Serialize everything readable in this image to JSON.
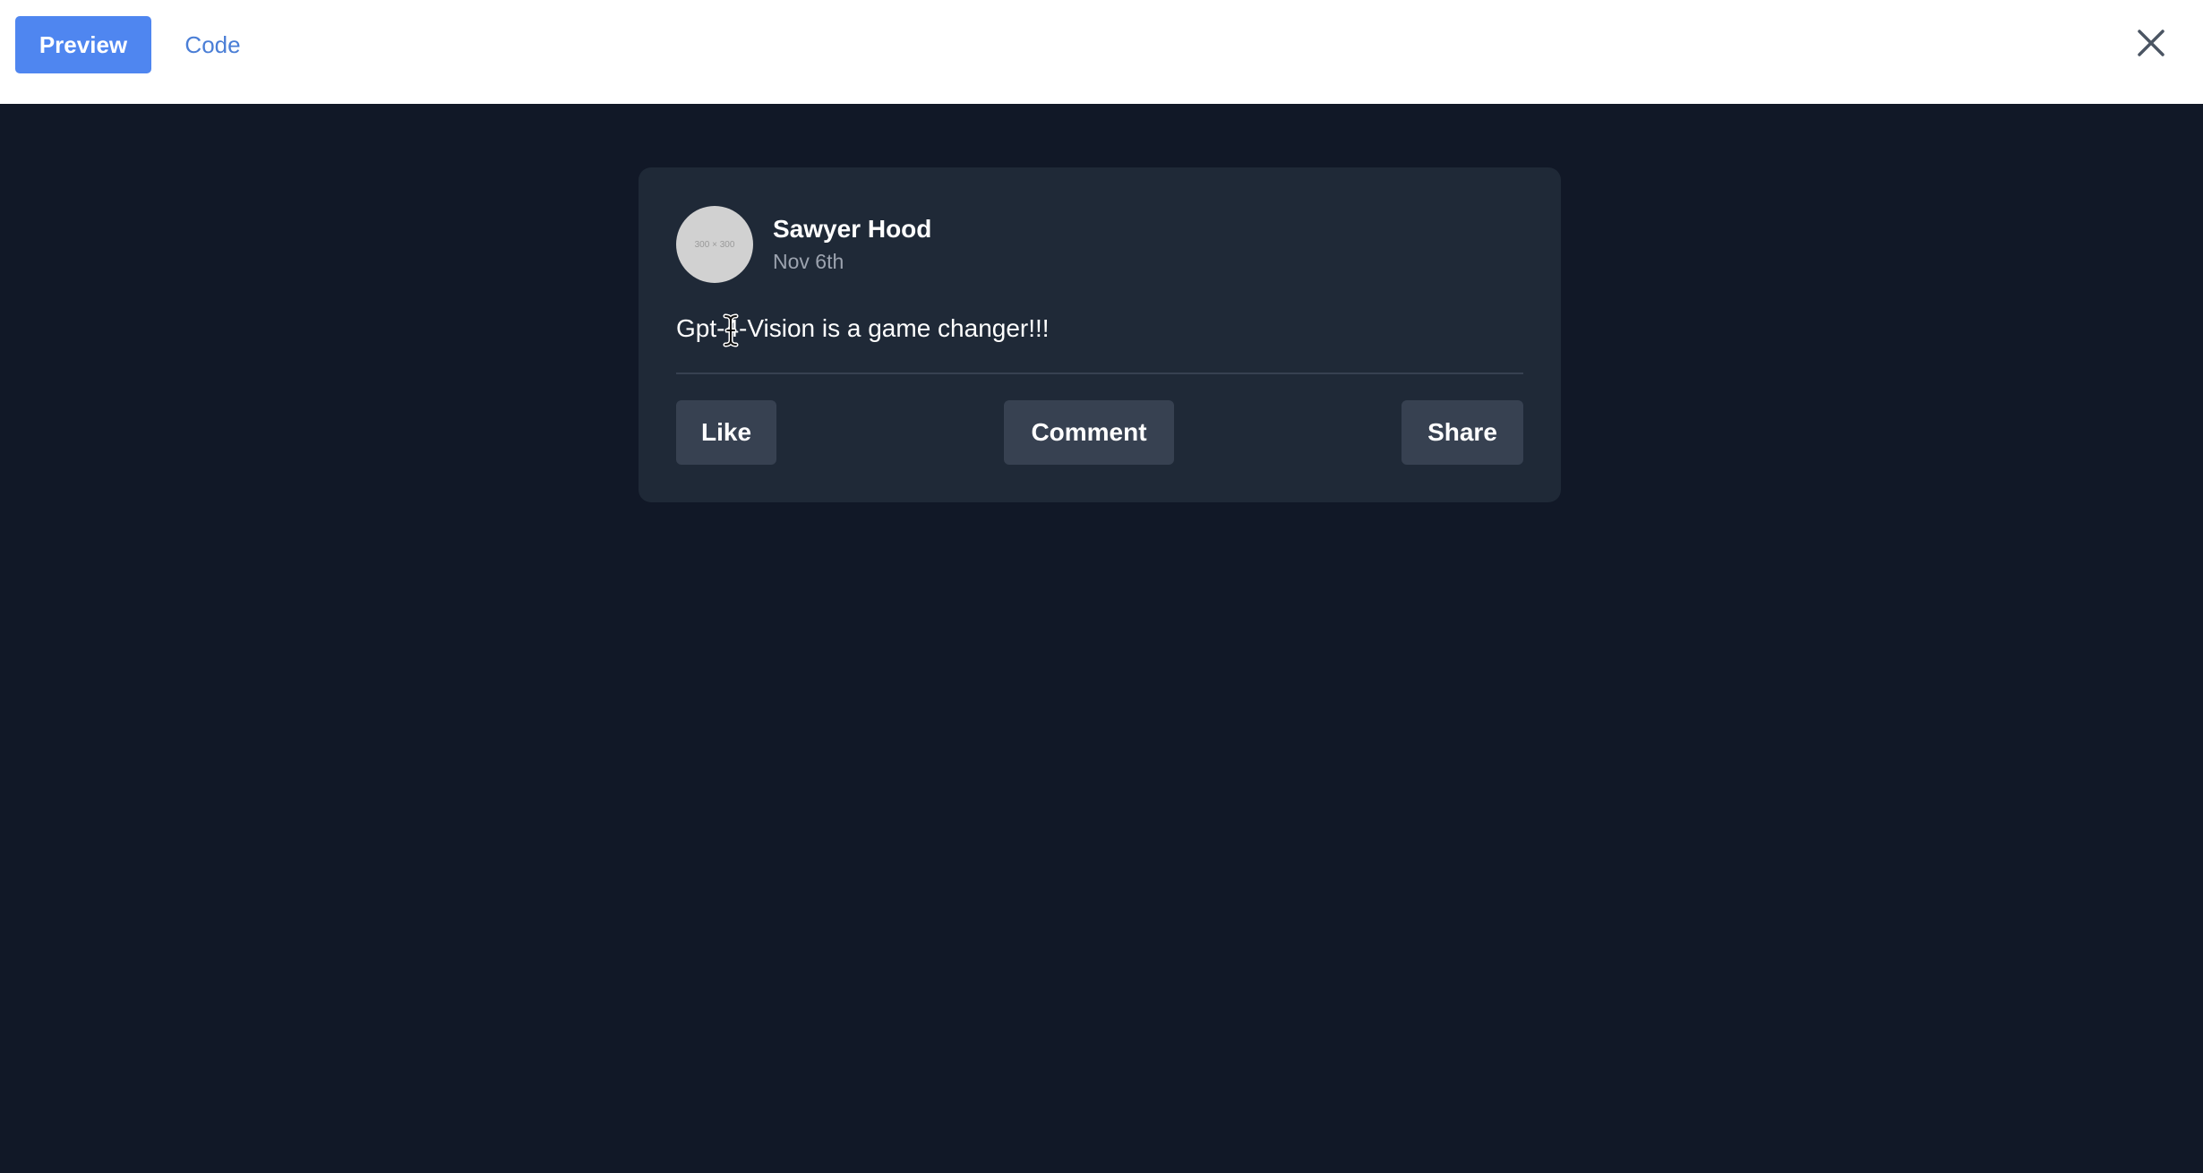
{
  "tabs": {
    "preview": "Preview",
    "code": "Code"
  },
  "post": {
    "avatar_placeholder": "300 × 300",
    "author": "Sawyer Hood",
    "date": "Nov 6th",
    "text": "Gpt-4-Vision is a game changer!!!",
    "actions": {
      "like": "Like",
      "comment": "Comment",
      "share": "Share"
    }
  },
  "icons": {
    "close": "close-icon",
    "cursor": "text-cursor-icon"
  },
  "colors": {
    "accent": "#4f86f0",
    "background": "#111827",
    "card": "#1f2937",
    "button": "#374151"
  }
}
